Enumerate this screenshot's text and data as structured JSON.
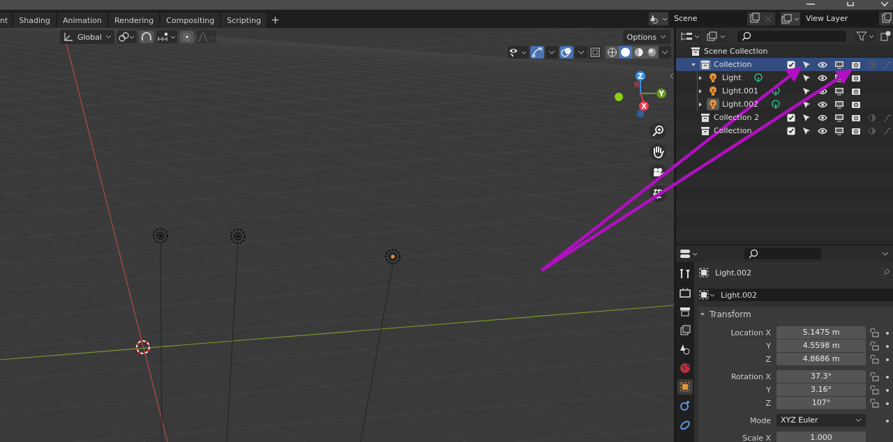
{
  "workspace_tabs": [
    {
      "label": "nt"
    },
    {
      "label": "Shading"
    },
    {
      "label": "Animation"
    },
    {
      "label": "Rendering"
    },
    {
      "label": "Compositing"
    },
    {
      "label": "Scripting"
    }
  ],
  "add_tab": "+",
  "scene": {
    "name": "Scene"
  },
  "view_layer": {
    "name": "View Layer"
  },
  "viewport": {
    "orientation": "Global",
    "options": "Options",
    "shading_modes": [
      {
        "kind": "wireframe",
        "selected": false
      },
      {
        "kind": "solid",
        "selected": true
      },
      {
        "kind": "material",
        "selected": false
      },
      {
        "kind": "rendered",
        "selected": false
      }
    ],
    "gizmo": {
      "z": "Z",
      "y": "Y",
      "x": "X"
    },
    "lights": [
      {
        "selected": false
      },
      {
        "selected": false
      },
      {
        "selected": true
      }
    ]
  },
  "outliner": {
    "root": "Scene Collection",
    "items": [
      {
        "name": "Collection",
        "selected": true,
        "expanded": true,
        "checked": true,
        "children": [
          {
            "name": "Light",
            "active": false,
            "expanded": false
          },
          {
            "name": "Light.001",
            "active": false,
            "expanded": false
          },
          {
            "name": "Light.002",
            "active": true,
            "expanded": false
          }
        ]
      },
      {
        "name": "Collection 2",
        "selected": false,
        "checked": true
      },
      {
        "name": "Collection",
        "selected": false,
        "checked": true
      }
    ]
  },
  "properties": {
    "tabs": [
      {
        "kind": "tool",
        "selected": false
      },
      {
        "kind": "render",
        "selected": false
      },
      {
        "kind": "output",
        "selected": false
      },
      {
        "kind": "view_layer",
        "selected": false
      },
      {
        "kind": "scene",
        "selected": false
      },
      {
        "kind": "world",
        "selected": false
      },
      {
        "kind": "object",
        "selected": true
      },
      {
        "kind": "physics",
        "selected": false
      },
      {
        "kind": "constraints",
        "selected": false
      }
    ],
    "object_name": "Light.002",
    "data_name": "Light.002",
    "panel": {
      "title": "Transform",
      "expanded": true
    },
    "groups": [
      {
        "rows": [
          {
            "label": "Location X",
            "value": "5.1475 m"
          },
          {
            "label": "Y",
            "value": "4.5598 m"
          },
          {
            "label": "Z",
            "value": "4.8686 m"
          }
        ]
      },
      {
        "rows": [
          {
            "label": "Rotation X",
            "value": "37.3°"
          },
          {
            "label": "Y",
            "value": "3.16°"
          },
          {
            "label": "Z",
            "value": "107°"
          }
        ]
      }
    ],
    "mode": {
      "label": "Mode",
      "value": "XYZ Euler"
    },
    "scale": {
      "label": "Scale X",
      "value": "1.000"
    }
  }
}
